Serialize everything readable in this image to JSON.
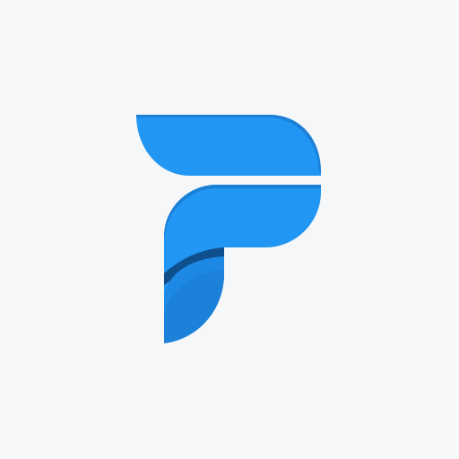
{
  "logo": {
    "icon": "letter-f-logo-icon",
    "colors": {
      "background": "#f5f7f8",
      "primary_blue": "#2196f3",
      "edge_blue": "#1b7fd6",
      "lower_blue": "#1e88e5",
      "dark_blue": "#1669b8",
      "shadow": "#0f4f8c"
    }
  }
}
